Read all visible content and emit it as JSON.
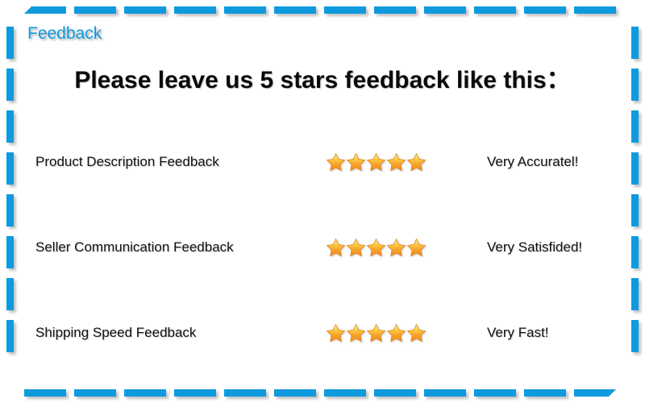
{
  "banner": {
    "section_label": "Feedback",
    "headline": "Please leave us 5 stars feedback like this：",
    "accent_color": "#0f9ade",
    "star_color_light": "#fdd44a",
    "star_color_dark": "#f08a1c",
    "background_color": "#ffffff",
    "text_color": "#111111"
  },
  "rows": [
    {
      "label": "Product Description Feedback",
      "stars": 5,
      "verdict": "Very Accuratel!"
    },
    {
      "label": "Seller Communication Feedback",
      "stars": 5,
      "verdict": "Very Satisfided!"
    },
    {
      "label": "Shipping Speed Feedback",
      "stars": 5,
      "verdict": "Very Fast!"
    }
  ]
}
